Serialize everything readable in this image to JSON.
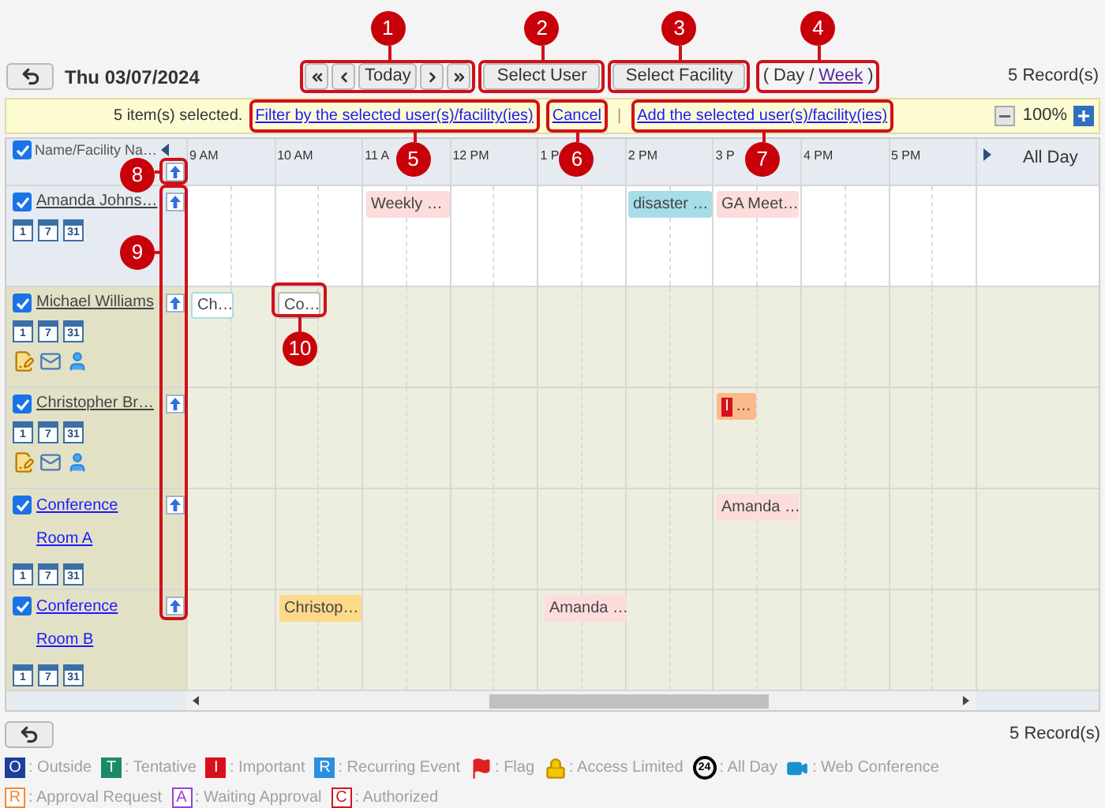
{
  "toolbar": {
    "date": "Thu 03/07/2024",
    "today": "Today",
    "select_user": "Select User",
    "select_facility": "Select Facility",
    "views_open": "(",
    "views": [
      {
        "label": "Day",
        "selected": true
      },
      {
        "label": "Week",
        "selected": false
      }
    ],
    "views_separator": "/",
    "views_close": ")",
    "record_count": "5 Record(s)"
  },
  "selection_bar": {
    "message": "5 item(s) selected.",
    "filter_link": "Filter by the selected user(s)/facility(ies)",
    "cancel_link": "Cancel",
    "separator": "|",
    "add_link": "Add the selected user(s)/facility(ies)",
    "zoom": "100%"
  },
  "grid": {
    "all_checked": true,
    "name_header": "Name/Facility Na…",
    "hours": [
      "9 AM",
      "10 AM",
      "11 A",
      "12 PM",
      "1 P",
      "2 PM",
      "3 P",
      "4 PM",
      "5 PM"
    ],
    "all_day": "All Day",
    "rows": [
      {
        "name": "Amanda Johns…",
        "kind": "self",
        "checked": true,
        "views": [
          "1",
          "7",
          "31"
        ],
        "events": [
          {
            "title": "Weekly …",
            "color": "#fddcdc"
          },
          {
            "title": "disaster …",
            "color": "#a6dde6"
          },
          {
            "title": "GA Meet…",
            "color": "#fddcdc"
          }
        ]
      },
      {
        "name": "Michael Williams",
        "kind": "user",
        "checked": true,
        "views": [
          "1",
          "7",
          "31"
        ],
        "events": [
          {
            "title": "Ch…",
            "color": "#ffffff"
          },
          {
            "title": "Co…",
            "color": "#ffffff"
          }
        ]
      },
      {
        "name": "Christopher Br…",
        "kind": "user",
        "checked": true,
        "views": [
          "1",
          "7",
          "31"
        ],
        "events": [
          {
            "title": "…",
            "badge": "I",
            "color": "#f9b98a"
          }
        ]
      },
      {
        "name": "Conference Room A",
        "kind": "facility",
        "checked": true,
        "views": [
          "1",
          "7",
          "31"
        ],
        "events": [
          {
            "title": "Amanda …",
            "color": "#fddcdc"
          }
        ]
      },
      {
        "name": "Conference Room B",
        "kind": "facility",
        "checked": true,
        "views": [
          "1",
          "7",
          "31"
        ],
        "events": [
          {
            "title": "Christop…",
            "color": "#fdd98a"
          },
          {
            "title": "Amanda …",
            "color": "#fddcdc"
          }
        ]
      }
    ]
  },
  "footer": {
    "record_count": "5 Record(s)"
  },
  "legend": [
    {
      "kind": "filled",
      "letter": "O",
      "color": "#1c3f9e",
      "label": ": Outside"
    },
    {
      "kind": "filled",
      "letter": "T",
      "color": "#1a8a6a",
      "label": ": Tentative"
    },
    {
      "kind": "filled",
      "letter": "I",
      "color": "#d8101c",
      "label": ": Important"
    },
    {
      "kind": "filled",
      "letter": "R",
      "color": "#2a8fe0",
      "label": ": Recurring Event"
    },
    {
      "kind": "flag",
      "label": ": Flag"
    },
    {
      "kind": "lock",
      "label": ": Access Limited"
    },
    {
      "kind": "allday",
      "letter": "24",
      "label": ": All Day"
    },
    {
      "kind": "video",
      "label": ": Web Conference"
    },
    {
      "kind": "outline",
      "letter": "R",
      "color": "#f08a30",
      "label": ": Approval Request"
    },
    {
      "kind": "outline",
      "letter": "A",
      "color": "#9a3fd8",
      "label": ": Waiting Approval"
    },
    {
      "kind": "outline",
      "letter": "C",
      "color": "#d8101c",
      "label": ": Authorized"
    }
  ],
  "callouts": [
    {
      "number": "1"
    },
    {
      "number": "2"
    },
    {
      "number": "3"
    },
    {
      "number": "4"
    },
    {
      "number": "5"
    },
    {
      "number": "6"
    },
    {
      "number": "7"
    },
    {
      "number": "8"
    },
    {
      "number": "9"
    },
    {
      "number": "10"
    }
  ]
}
